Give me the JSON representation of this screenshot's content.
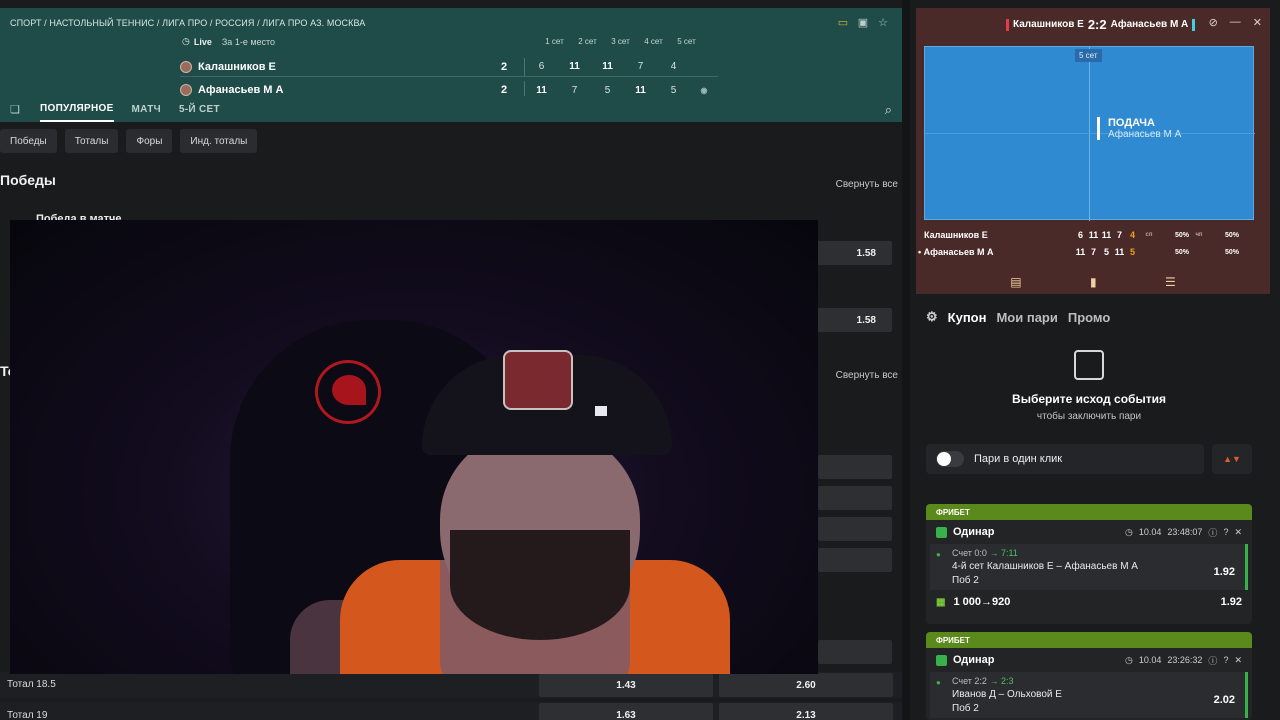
{
  "breadcrumb": "СПОРТ / НАСТОЛЬНЫЙ ТЕННИС / ЛИГА ПРО / РОССИЯ / ЛИГА ПРО АЗ. МОСКВА",
  "match": {
    "live_label": "Live",
    "live_sub": "За 1-е место",
    "set_headers": [
      "1 сет",
      "2 сет",
      "3 сет",
      "4 сет",
      "5 сет"
    ],
    "player1": {
      "name": "Калашников Е",
      "total": "2",
      "sets": [
        "6",
        "11",
        "11",
        "7",
        "4"
      ]
    },
    "player2": {
      "name": "Афанасьев М А",
      "total": "2",
      "sets": [
        "11",
        "7",
        "5",
        "11",
        "5"
      ]
    }
  },
  "tabs": [
    "ПОПУЛЯРНОЕ",
    "МАТЧ",
    "5-Й СЕТ"
  ],
  "chips": [
    "Победы",
    "Тоталы",
    "Форы",
    "Инд. тоталы"
  ],
  "markets": {
    "wins_title": "Победы",
    "collapse_all": "Свернуть все",
    "win_match_label": "Победа в матче",
    "odd_a": "1.58",
    "odd_b": "1.58",
    "totals_title_partial": "То",
    "collapse_all_2": "Свернуть все",
    "totals_rows": [
      {
        "label": "Тотал 18.5",
        "over": "1.43",
        "under": "2.60"
      },
      {
        "label": "Тотал 19",
        "over": "1.63",
        "under": "2.13"
      }
    ]
  },
  "tracker": {
    "p1": "Калашников Е",
    "score": "2:2",
    "p2": "Афанасьев М А",
    "set_label": "5 сет",
    "serve_title": "ПОДАЧА",
    "serve_player": "Афанасьев М А",
    "row1": {
      "name": "Калашников Е",
      "sets": [
        "6",
        "11",
        "11",
        "7",
        "4"
      ],
      "pct1": "50%",
      "pct2": "50%"
    },
    "row2": {
      "name": "• Афанасьев М А",
      "sets": [
        "11",
        "7",
        "5",
        "11",
        "5"
      ],
      "pct1": "50%",
      "pct2": "50%"
    },
    "lbl1": "сп",
    "lbl2": "чп"
  },
  "coupon": {
    "tabs": [
      "Купон",
      "Мои пари",
      "Промо"
    ],
    "empty_title": "Выберите исход события",
    "empty_sub": "чтобы заключить пари",
    "one_click": "Пари в один клик"
  },
  "bets": [
    {
      "freebet": "ФРИБЕТ",
      "type": "Одинар",
      "date": "10.04",
      "time": "23:48:07",
      "score_prefix": "Счет 0:0",
      "score_change": "→ 7:11",
      "event": "4-й сет Калашников Е – Афанасьев М А",
      "pick": "Поб 2",
      "odd": "1.92",
      "stake": "1 000→920",
      "total_odd": "1.92"
    },
    {
      "freebet": "ФРИБЕТ",
      "type": "Одинар",
      "date": "10.04",
      "time": "23:26:32",
      "score_prefix": "Счет 2:2",
      "score_change": "→ 2:3",
      "event": "Иванов Д – Ольховой Е",
      "pick": "Поб 2",
      "odd": "2.02"
    }
  ]
}
